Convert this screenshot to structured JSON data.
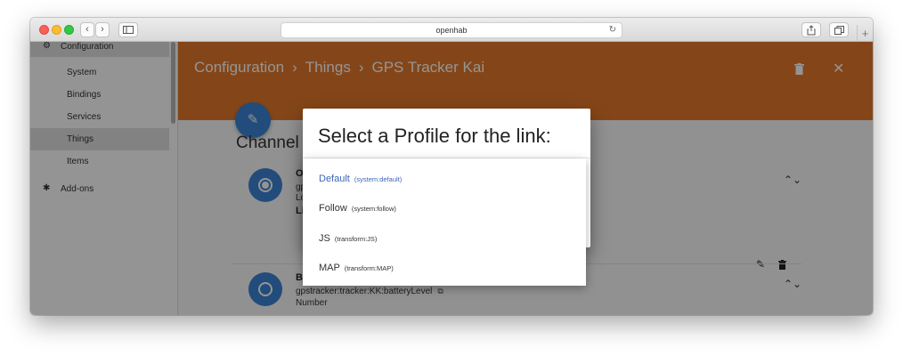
{
  "browser": {
    "address": "openhab"
  },
  "sidebar": {
    "section_configuration": "Configuration",
    "items": [
      {
        "label": "System"
      },
      {
        "label": "Bindings"
      },
      {
        "label": "Services"
      },
      {
        "label": "Things"
      },
      {
        "label": "Items"
      }
    ],
    "section_addons": "Add-ons",
    "active_item": "Things"
  },
  "header": {
    "breadcrumb": [
      "Configuration",
      "Things",
      "GPS Tracker Kai"
    ],
    "separator": "›",
    "background_color": "#e4792a"
  },
  "main": {
    "section_title": "Channel",
    "channels": [
      {
        "name": "O",
        "uid": "gp",
        "type": "Lo",
        "linked_label": "Li",
        "icon": "radio-checked-icon"
      },
      {
        "name": "Ba",
        "uid": "gpstracker:tracker:KK:batteryLevel",
        "type": "Number",
        "icon": "radio-unchecked-icon"
      }
    ]
  },
  "dialog": {
    "title": "Select a Profile for the link:",
    "options": [
      {
        "label": "Default",
        "id": "(system:default)",
        "selected": true
      },
      {
        "label": "Follow",
        "id": "(system:follow)",
        "selected": false
      },
      {
        "label": "JS",
        "id": "(transform:JS)",
        "selected": false
      },
      {
        "label": "MAP",
        "id": "(transform:MAP)",
        "selected": false
      }
    ]
  },
  "colors": {
    "accent_blue": "#3b83d5",
    "selected_option": "#3b66b8"
  }
}
